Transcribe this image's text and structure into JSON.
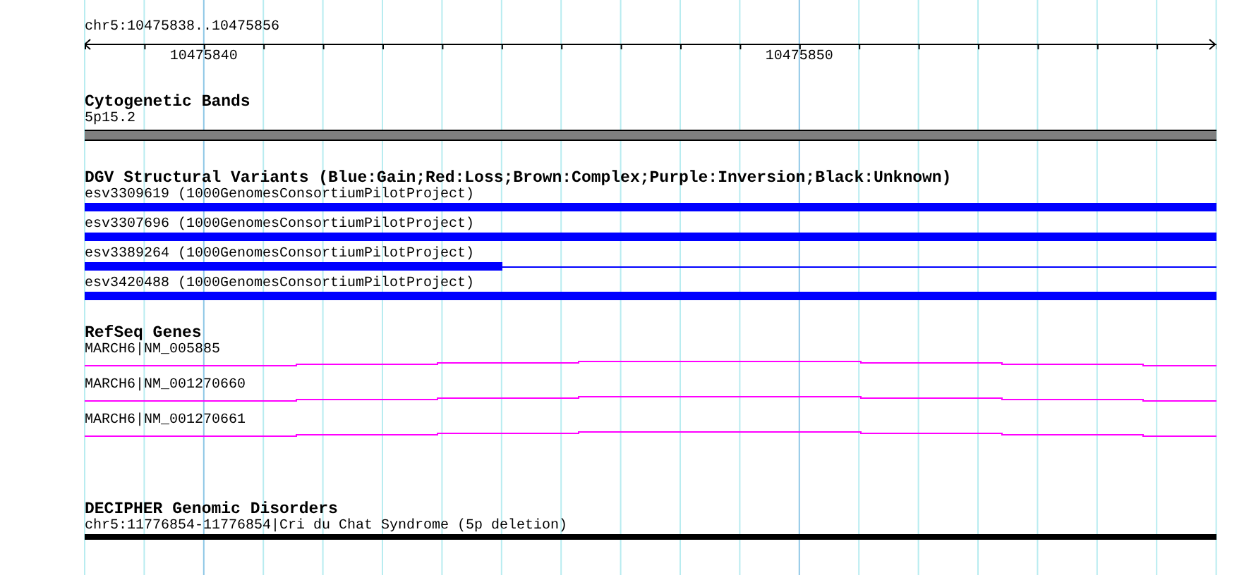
{
  "ruler": {
    "range": "chr5:10475838..10475856",
    "tick_labels": [
      "10475840",
      "10475850"
    ]
  },
  "tracks": [
    {
      "kind": "cytoband",
      "title": "Cytogenetic Bands",
      "features": [
        {
          "label": "5p15.2"
        }
      ]
    },
    {
      "kind": "variants",
      "title": "DGV Structural Variants (Blue:Gain;Red:Loss;Brown:Complex;Purple:Inversion;Black:Unknown)",
      "features": [
        {
          "label": "esv3309619 (1000GenomesConsortiumPilotProject)",
          "kind": "full"
        },
        {
          "label": "esv3307696 (1000GenomesConsortiumPilotProject)",
          "kind": "full"
        },
        {
          "label": "esv3389264 (1000GenomesConsortiumPilotProject)",
          "kind": "partial"
        },
        {
          "label": "esv3420488 (1000GenomesConsortiumPilotProject)",
          "kind": "full"
        }
      ]
    },
    {
      "kind": "genes",
      "title": "RefSeq Genes",
      "features": [
        {
          "label": "MARCH6|NM_005885"
        },
        {
          "label": "MARCH6|NM_001270660"
        },
        {
          "label": "MARCH6|NM_001270661"
        }
      ]
    },
    {
      "kind": "disorders",
      "title": "DECIPHER Genomic Disorders",
      "features": [
        {
          "label": "chr5:11776854-11776854|Cri du Chat Syndrome (5p deletion)"
        }
      ]
    }
  ]
}
